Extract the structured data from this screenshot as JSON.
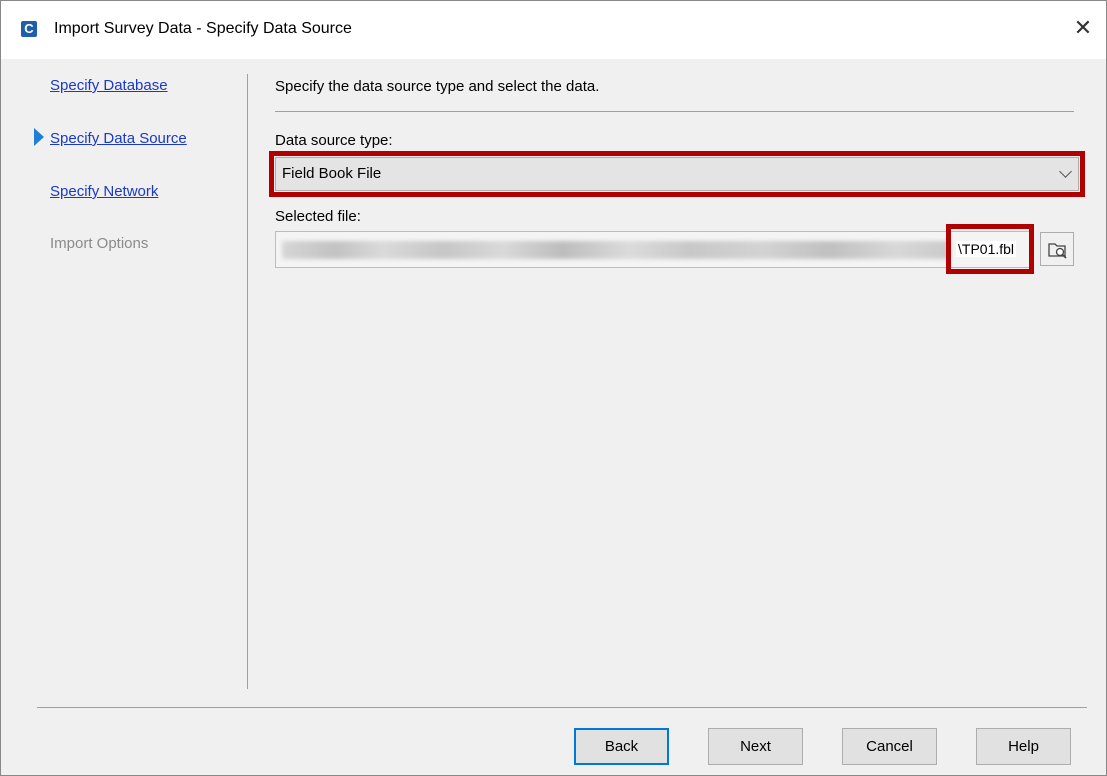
{
  "window": {
    "title": "Import Survey Data - Specify Data Source",
    "app_icon_glyph": "C",
    "close_glyph": "✕"
  },
  "nav": {
    "items": [
      {
        "label": "Specify Database",
        "state": "link"
      },
      {
        "label": "Specify Data Source",
        "state": "current"
      },
      {
        "label": "Specify Network",
        "state": "link"
      },
      {
        "label": "Import Options",
        "state": "disabled"
      }
    ]
  },
  "content": {
    "instructions": "Specify the data source type and select the data.",
    "data_source_label": "Data source type:",
    "data_source_value": "Field Book File",
    "selected_file_label": "Selected file:",
    "selected_file_visible_tail": "\\TP01.fbl"
  },
  "buttons": {
    "back": "Back",
    "next": "Next",
    "cancel": "Cancel",
    "help": "Help"
  },
  "colors": {
    "highlight": "#b00000",
    "link": "#1a39c9",
    "current_arrow": "#1e7fd4",
    "default_button_border": "#0078d7"
  }
}
